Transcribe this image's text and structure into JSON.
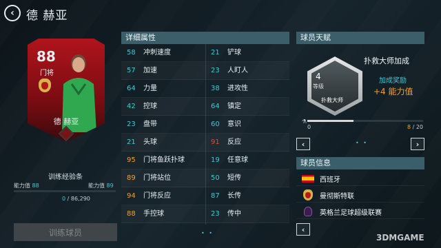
{
  "header": {
    "title": "德 赫亚"
  },
  "card": {
    "overall": "88",
    "position": "门将",
    "name": "德 赫亚"
  },
  "training": {
    "label": "训练经验条",
    "left_label": "能力值",
    "left_value": "88",
    "right_label": "能力值",
    "right_value": "89",
    "progress_text_current": "0",
    "progress_text_total": " / 86,290",
    "progress_fraction": 0.0,
    "button_label": "训练球员"
  },
  "attributes": {
    "title": "详细属性",
    "left": [
      {
        "value": "58",
        "label": "冲刺速度",
        "color": "cyan"
      },
      {
        "value": "57",
        "label": "加速",
        "color": "cyan"
      },
      {
        "value": "64",
        "label": "力量",
        "color": "cyan"
      },
      {
        "value": "42",
        "label": "控球",
        "color": "cyan"
      },
      {
        "value": "23",
        "label": "盘带",
        "color": "cyan"
      },
      {
        "value": "21",
        "label": "头球",
        "color": "cyan"
      },
      {
        "value": "95",
        "label": "门将鱼跃扑球",
        "color": "orange"
      },
      {
        "value": "89",
        "label": "门将站位",
        "color": "orange"
      },
      {
        "value": "94",
        "label": "门将反应",
        "color": "orange"
      },
      {
        "value": "88",
        "label": "手控球",
        "color": "orange"
      }
    ],
    "right": [
      {
        "value": "21",
        "label": "铲球",
        "color": "cyan"
      },
      {
        "value": "23",
        "label": "人盯人",
        "color": "cyan"
      },
      {
        "value": "38",
        "label": "进攻性",
        "color": "cyan"
      },
      {
        "value": "64",
        "label": "镇定",
        "color": "cyan"
      },
      {
        "value": "60",
        "label": "意识",
        "color": "cyan"
      },
      {
        "value": "91",
        "label": "反应",
        "color": "red"
      },
      {
        "value": "19",
        "label": "任意球",
        "color": "cyan"
      },
      {
        "value": "50",
        "label": "短传",
        "color": "cyan"
      },
      {
        "value": "87",
        "label": "长传",
        "color": "cyan"
      },
      {
        "value": "23",
        "label": "传中",
        "color": "cyan"
      }
    ],
    "pagination": "• •"
  },
  "talent": {
    "title": "球员天赋",
    "level": "4",
    "level_label": "等级",
    "badge_text": "扑救大师",
    "name": "扑救大师加成",
    "reward_label": "加成奖励",
    "reward_value": "+4 能力值",
    "progress_min": "0",
    "progress_current": "8",
    "progress_total": " / 20",
    "progress_fraction": 0.4,
    "pagination": "• •",
    "prev_label": "‹",
    "next_label": "›"
  },
  "info": {
    "title": "球员信息",
    "nation": "西班牙",
    "club": "曼彻斯特联",
    "league": "英格兰足球超级联赛",
    "prev_label": "‹"
  },
  "watermark": "3DMGAME",
  "colors": {
    "cyan": "#41c7d6",
    "orange": "#f0a030",
    "red": "#e24a2c",
    "panel_head": "#3a5f6b"
  }
}
